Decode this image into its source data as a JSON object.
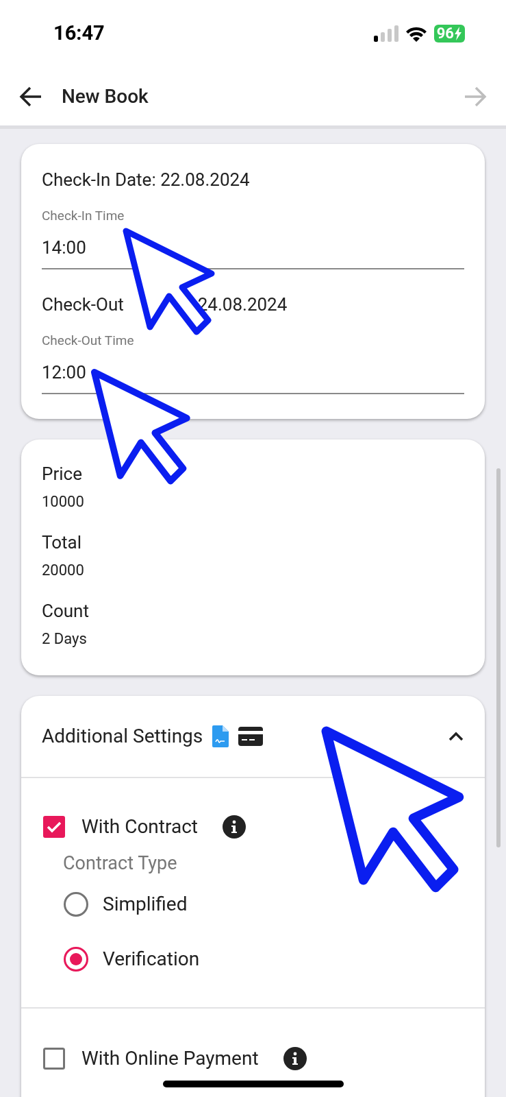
{
  "status_bar": {
    "time": "16:47",
    "battery": "96",
    "charging": true
  },
  "header": {
    "title": "New Book",
    "forward_disabled": true
  },
  "dates_card": {
    "check_in_label": "Check-In Date: 22.08.2024",
    "check_in_time": {
      "label": "Check-In Time",
      "value": "14:00"
    },
    "check_out_label_parts": [
      "Check-Out",
      "24.08.2024"
    ],
    "check_out_time": {
      "label": "Check-Out Time",
      "value": "12:00"
    }
  },
  "summary_card": [
    {
      "label": "Price",
      "value": "10000"
    },
    {
      "label": "Total",
      "value": "20000"
    },
    {
      "label": "Count",
      "value": "2 Days"
    }
  ],
  "additional_settings": {
    "title": "Additional Settings",
    "expanded": true,
    "with_contract": {
      "label": "With Contract",
      "checked": true,
      "contract_type_label": "Contract Type",
      "options": [
        {
          "label": "Simplified",
          "selected": false
        },
        {
          "label": "Verification",
          "selected": true
        }
      ]
    },
    "with_online_payment": {
      "label": "With Online Payment",
      "checked": false
    }
  }
}
